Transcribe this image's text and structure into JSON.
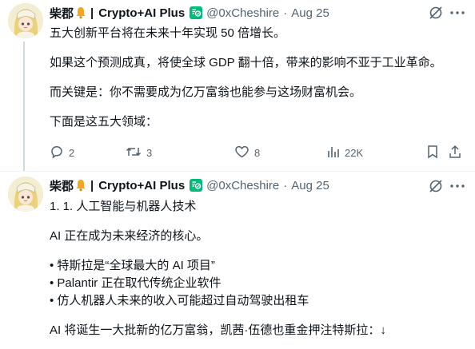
{
  "tweet1": {
    "name": "柴郡",
    "separator": "|",
    "subtitle": "Crypto+AI Plus",
    "handle": "@0xCheshire",
    "dot": "·",
    "date": "Aug 25",
    "lines": [
      "五大创新平台将在未来十年实现 50 倍增长。",
      "",
      "如果这个预测成真，将使全球 GDP 翻十倍，带来的影响不亚于工业革命。",
      "",
      "而关键是：你不需要成为亿万富翁也能参与这场财富机会。",
      "",
      "下面是这五大领域："
    ],
    "replies": "2",
    "retweets": "3",
    "likes": "8",
    "views": "22K"
  },
  "tweet2": {
    "name": "柴郡",
    "separator": "|",
    "subtitle": "Crypto+AI Plus",
    "handle": "@0xCheshire",
    "dot": "·",
    "date": "Aug 25",
    "lines": [
      "1. 1. 人工智能与机器人技术",
      "",
      "AI 正在成为未来经济的核心。",
      "",
      "• 特斯拉是“全球最大的 AI 项目”",
      "• Palantir 正在取代传统企业软件",
      "• 仿人机器人未来的收入可能超过自动驾驶出租车",
      "",
      "AI 将诞生一大批新的亿万富翁，凯茜·伍德也重金押注特斯拉：↓"
    ]
  },
  "icons": [
    "avatar",
    "bell-icon",
    "verified-badge-icon",
    "grok-icon",
    "more-icon",
    "reply-icon",
    "retweet-icon",
    "like-icon",
    "views-icon",
    "bookmark-icon",
    "share-icon"
  ],
  "colors": {
    "text": "#0f1419",
    "muted": "#536471",
    "badge": "#00ba7c",
    "bell": "#f4a623",
    "thread": "#cfd9de"
  }
}
